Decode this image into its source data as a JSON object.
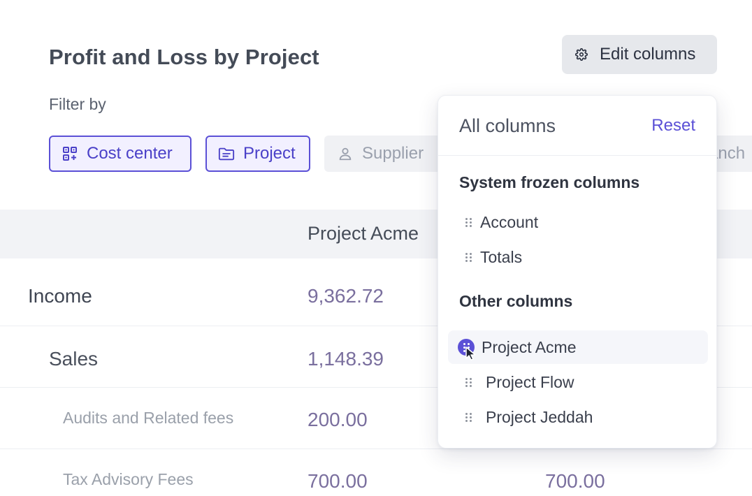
{
  "header": {
    "title": "Profit and Loss by Project",
    "edit_columns_label": "Edit columns",
    "edit_columns_icon": "gear-icon"
  },
  "filters": {
    "label": "Filter by",
    "chips": [
      {
        "label": "Cost center",
        "icon": "cost-center-icon",
        "active": true
      },
      {
        "label": "Project",
        "icon": "folder-icon",
        "active": true
      },
      {
        "label": "Supplier",
        "icon": "person-icon",
        "active": false
      },
      {
        "label": "Branch",
        "icon": "branch-icon",
        "active": false
      }
    ],
    "branch_partial_text": "ranch"
  },
  "table": {
    "columns": [
      "Project Acme"
    ],
    "rows": [
      {
        "label": "Income",
        "values": [
          "9,362.72"
        ]
      },
      {
        "label": "Sales",
        "values": [
          "1,148.39"
        ]
      },
      {
        "label": "Audits and Related fees",
        "values": [
          "200.00"
        ]
      },
      {
        "label": "Tax Advisory Fees",
        "values": [
          "700.00",
          "700.00"
        ]
      }
    ]
  },
  "columns_panel": {
    "title": "All columns",
    "reset_label": "Reset",
    "frozen_section_title": "System frozen columns",
    "frozen_columns": [
      "Account",
      "Totals"
    ],
    "other_section_title": "Other columns",
    "other_columns": [
      "Project Acme",
      "Project Flow",
      "Project Jeddah"
    ],
    "dragging_column": "Project Acme"
  },
  "colors": {
    "accent": "#5b50d6",
    "value_text": "#7a6f9e",
    "header_bg": "#f2f3f6"
  }
}
